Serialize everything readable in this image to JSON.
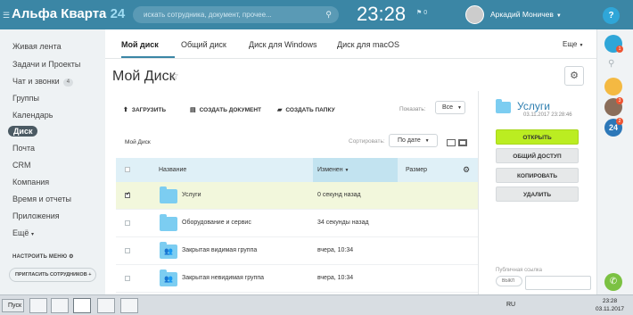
{
  "header": {
    "brand_main": "Альфа Кварта",
    "brand_num": "24",
    "search_placeholder": "искать сотрудника, документ, прочее...",
    "time": "23:28",
    "flag_count": "0",
    "user_name": "Аркадий Моничев",
    "help_label": "?"
  },
  "sidebar": {
    "items": [
      {
        "label": "Живая лента"
      },
      {
        "label": "Задачи и Проекты"
      },
      {
        "label": "Чат и звонки",
        "count": "4"
      },
      {
        "label": "Группы"
      },
      {
        "label": "Календарь"
      },
      {
        "label": "Диск"
      },
      {
        "label": "Почта"
      },
      {
        "label": "CRM"
      },
      {
        "label": "Компания"
      },
      {
        "label": "Время и отчеты"
      },
      {
        "label": "Приложения"
      },
      {
        "label": "Ещё"
      }
    ],
    "settings_label": "НАСТРОИТЬ МЕНЮ",
    "invite_label": "ПРИГЛАСИТЬ СОТРУДНИКОВ"
  },
  "tabs": [
    "Мой диск",
    "Общий диск",
    "Диск для Windows",
    "Диск для macOS"
  ],
  "more_label": "Еще",
  "page_title": "Мой Диск",
  "toolbar": {
    "upload": "ЗАГРУЗИТЬ",
    "create_doc": "СОЗДАТЬ ДОКУМЕНТ",
    "create_folder": "СОЗДАТЬ ПАПКУ",
    "show_label": "Показать:",
    "show_value": "Все"
  },
  "breadcrumb": "Мой Диск",
  "sort": {
    "label": "Сортировать:",
    "value": "По дате"
  },
  "table": {
    "columns": [
      "Название",
      "Изменен",
      "Размер"
    ],
    "rows": [
      {
        "name": "Услуги",
        "modified": "0 секунд назад",
        "type": "folder"
      },
      {
        "name": "Оборудование и сервис",
        "modified": "34 секунды назад",
        "type": "folder"
      },
      {
        "name": "Закрытая видимая группа",
        "modified": "вчера, 10:34",
        "type": "group"
      },
      {
        "name": "Закрытая невидимая группа",
        "modified": "вчера, 10:34",
        "type": "group"
      }
    ]
  },
  "details": {
    "name": "Услуги",
    "date": "03.11.2017 23:28:46",
    "buttons": [
      "ОТКРЫТЬ",
      "ОБЩИЙ ДОСТУП",
      "КОПИРОВАТЬ",
      "УДАЛИТЬ"
    ],
    "public_link_label": "Публичная ссылка",
    "toggle_label": "ВЫКЛ"
  },
  "rightbar": {
    "badge1": "1",
    "badge2": "3",
    "badge3": "2",
    "logo": "24"
  },
  "taskbar": {
    "start": "Пуск",
    "lang": "RU",
    "time": "23:28",
    "date": "03.11.2017"
  },
  "colors": {
    "accent": "#3b86a5",
    "open_button": "#bbed21",
    "folder": "#7ccdf1"
  }
}
